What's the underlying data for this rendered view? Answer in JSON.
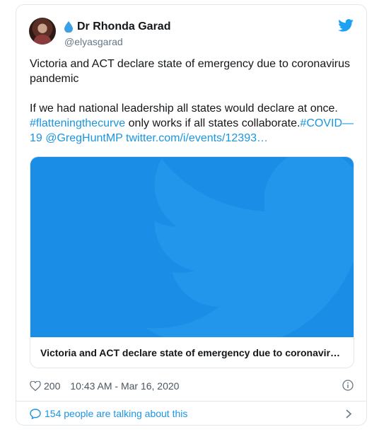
{
  "author": {
    "name": "Dr Rhonda Garad",
    "handle": "@elyasgarad"
  },
  "tweet": {
    "line1": "Victoria and ACT declare state of emergency due to coronavirus",
    "line2": "pandemic",
    "line3": "If we had national leadership all states would declare at once.",
    "hashtag_flattening": "#flatteningthecurve",
    "mid_text": " only works if all states collaborate.",
    "hashtag_covid_a": "#COVID—",
    "hashtag_covid_b": "19",
    "mention": " @GregHuntMP",
    "url": " twitter.com/i/events/12393…"
  },
  "card": {
    "caption": "Victoria and ACT declare state of emergency due to coronavir…"
  },
  "meta": {
    "likes": "200",
    "timestamp": "10:43 AM - Mar 16, 2020"
  },
  "footer": {
    "talking": "154 people are talking about this"
  },
  "colors": {
    "accent": "#1b95e0",
    "media_blue": "#1a8ee6",
    "text": "#14171a",
    "muted": "#657786"
  },
  "icons": [
    "water-drop-icon",
    "twitter-bird-icon",
    "heart-icon",
    "info-icon",
    "speech-bubble-icon",
    "chevron-right-icon"
  ]
}
